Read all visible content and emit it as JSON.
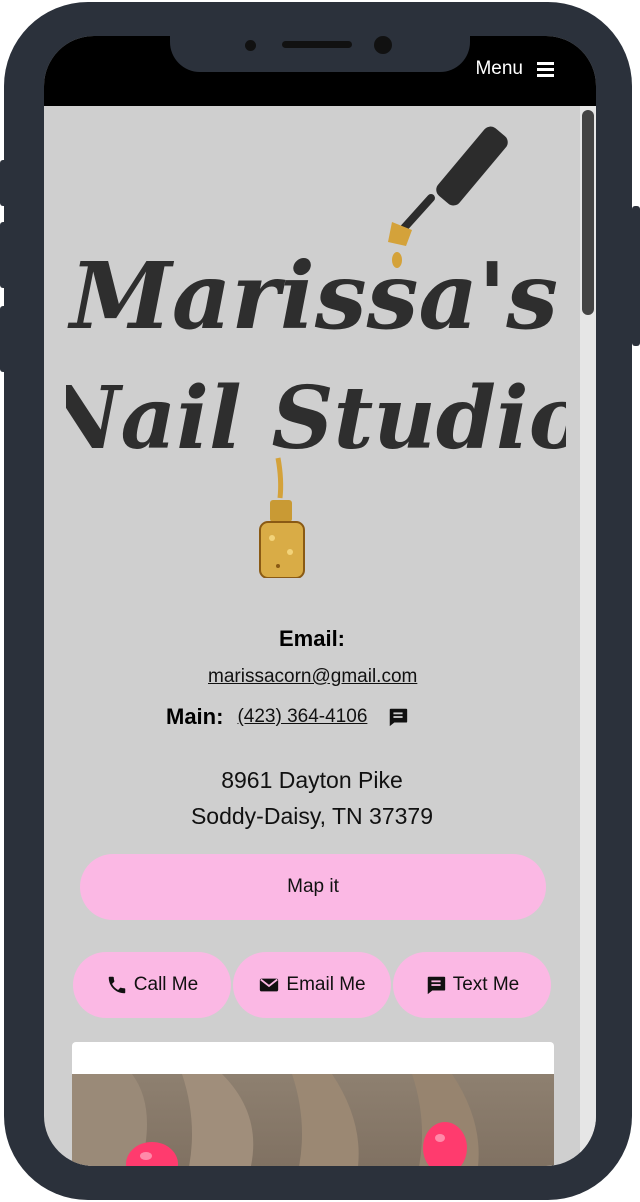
{
  "header": {
    "menu_label": "Menu"
  },
  "logo": {
    "line1": "Marissa's",
    "line2": "Nail Studio"
  },
  "contact": {
    "email_label": "Email:",
    "email": "marissacorn@gmail.com",
    "main_label": "Main:",
    "phone": "(423) 364-4106",
    "address_line1": "8961 Dayton Pike",
    "address_line2": "Soddy-Daisy, TN 37379"
  },
  "buttons": {
    "map": "Map it",
    "call": "Call Me",
    "email": "Email Me",
    "text": "Text Me"
  },
  "colors": {
    "button_pink": "#fbb8e4",
    "background_gray": "#cfcfcf",
    "frame": "#2b313b"
  }
}
